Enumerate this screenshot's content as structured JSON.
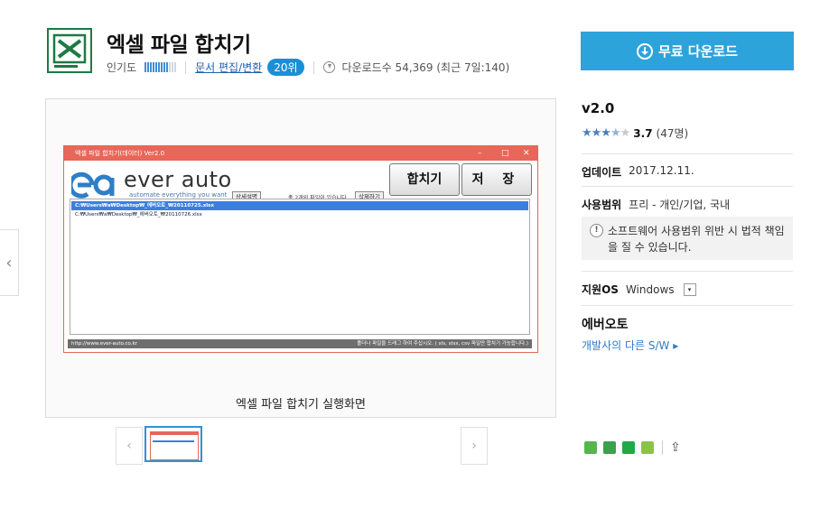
{
  "header": {
    "title": "엑셀 파일 합치기",
    "popularity_label": "인기도",
    "popularity_level": 0.85,
    "category": "문서 편집/변환",
    "rank": "20위",
    "downloads": "다운로드수 54,369 (최근 7일:140)"
  },
  "preview": {
    "caption": "엑셀 파일 합치기 실행화면",
    "window": {
      "title": "엑셀 파일 합치기(데이터) Ver2.0",
      "controls": [
        "–",
        "□",
        "✕"
      ],
      "logo": "ever auto",
      "logo_sub": "automate everything you want",
      "detail_button": "상세설명",
      "count_text": "총 2개의 파일이 있습니다.",
      "delete_button": "삭제하기",
      "merge_button": "합치기",
      "save_button": "저 장",
      "files": [
        "C:₩Users₩a₩Desktop₩_에버오토_₩20110725.xlsx",
        "C:₩Users₩a₩Desktop₩_에버오토_₩20110726.xlsx"
      ],
      "status_url": "http://www.ever-auto.co.kr",
      "status_hint": "폴더나 파일을 드래그 하여 주십시오. ( xls, xlsx, csv 파일만 합치기 가능합니다.)"
    }
  },
  "thumbnails": {
    "prev": "‹",
    "next": "›"
  },
  "sidebar": {
    "download_button": "무료 다운로드",
    "version": "v2.0",
    "rating_score": "3.7",
    "rating_count": "(47명)",
    "rating_value": 3.7,
    "update_label": "업데이트",
    "update_value": "2017.12.11.",
    "license_label": "사용범위",
    "license_value": "프리 - 개인/기업, 국내",
    "warning": "소프트웨어 사용범위 위반 시 법적 책임을 질 수 있습니다.",
    "os_label": "지원OS",
    "os_value": "Windows",
    "developer": "에버오토",
    "developer_link": "개발사의 다른 S/W ▸"
  },
  "nav": {
    "left_arrow": "‹"
  },
  "colors": {
    "accent": "#2da3dc",
    "window_title": "#e8665a",
    "selection": "#3a7fe0"
  }
}
